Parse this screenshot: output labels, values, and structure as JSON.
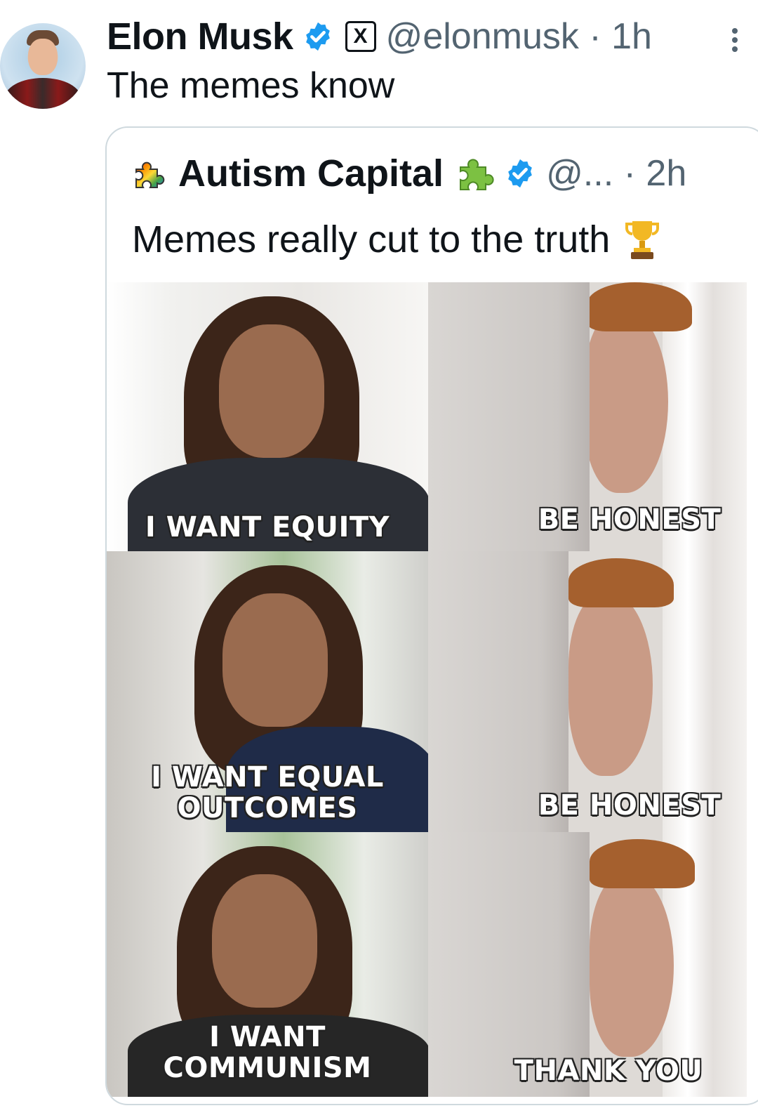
{
  "tweet": {
    "author_name": "Elon Musk",
    "handle": "@elonmusk",
    "time_sep": " · ",
    "time": "1h",
    "text": "The memes know"
  },
  "quoted": {
    "author_name": "Autism Capital",
    "handle": "@...",
    "time_sep": " · ",
    "time": "2h",
    "text": "Memes really cut to the truth"
  },
  "meme": {
    "left_captions": [
      [
        "I WANT EQUITY"
      ],
      [
        "I WANT EQUAL",
        "OUTCOMES"
      ],
      [
        "I WANT",
        "COMMUNISM"
      ]
    ],
    "right_captions": [
      "BE HONEST",
      "BE HONEST",
      "THANK YOU"
    ]
  },
  "colors": {
    "verified_blue": "#1d9bf0",
    "secondary_text": "#536471",
    "border": "#cfd9de"
  },
  "icons": {
    "verified": "verified-badge-icon",
    "x_logo": "x-logo-icon",
    "more": "more-options-icon",
    "puzzle": "puzzle-icon",
    "trophy": "trophy-icon"
  }
}
